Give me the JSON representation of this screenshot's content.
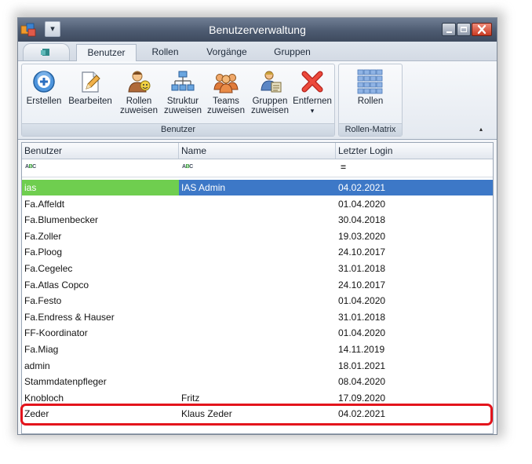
{
  "window": {
    "title": "Benutzerverwaltung",
    "qat_glyph": "▾"
  },
  "tabs": [
    "Benutzer",
    "Rollen",
    "Vorgänge",
    "Gruppen"
  ],
  "ribbon": {
    "buttons": [
      {
        "line1": "Erstellen",
        "line2": ""
      },
      {
        "line1": "Bearbeiten",
        "line2": ""
      },
      {
        "line1": "Rollen",
        "line2": "zuweisen"
      },
      {
        "line1": "Struktur",
        "line2": "zuweisen"
      },
      {
        "line1": "Teams",
        "line2": "zuweisen"
      },
      {
        "line1": "Gruppen",
        "line2": "zuweisen"
      },
      {
        "line1": "Entfernen",
        "line2": "▾"
      }
    ],
    "group1_label": "Benutzer",
    "matrix_button": "Rollen",
    "group2_label": "Rollen-Matrix",
    "collapse_glyph": "▴"
  },
  "grid": {
    "columns": [
      "Benutzer",
      "Name",
      "Letzter Login"
    ],
    "filter": {
      "text_icon": "ABC",
      "date_icon": "="
    },
    "rows": [
      {
        "user": "ias",
        "name": "IAS Admin",
        "login": "04.02.2021"
      },
      {
        "user": "Fa.Affeldt",
        "name": "",
        "login": "01.04.2020"
      },
      {
        "user": "Fa.Blumenbecker",
        "name": "",
        "login": "30.04.2018"
      },
      {
        "user": "Fa.Zoller",
        "name": "",
        "login": "19.03.2020"
      },
      {
        "user": "Fa.Ploog",
        "name": "",
        "login": "24.10.2017"
      },
      {
        "user": "Fa.Cegelec",
        "name": "",
        "login": "31.01.2018"
      },
      {
        "user": "Fa.Atlas Copco",
        "name": "",
        "login": "24.10.2017"
      },
      {
        "user": "Fa.Festo",
        "name": "",
        "login": "01.04.2020"
      },
      {
        "user": "Fa.Endress & Hauser",
        "name": "",
        "login": "31.01.2018"
      },
      {
        "user": "FF-Koordinator",
        "name": "",
        "login": "01.04.2020"
      },
      {
        "user": "Fa.Miag",
        "name": "",
        "login": "14.11.2019"
      },
      {
        "user": "admin",
        "name": "",
        "login": "18.01.2021"
      },
      {
        "user": "Stammdatenpfleger",
        "name": "",
        "login": "08.04.2020"
      },
      {
        "user": "Knobloch",
        "name": "Fritz",
        "login": "17.09.2020"
      },
      {
        "user": "Zeder",
        "name": "Klaus Zeder",
        "login": "04.02.2021"
      }
    ]
  },
  "colors": {
    "selected_row": "#3d78c7",
    "selected_cell": "#6fce4f",
    "highlight_box": "#e3141c",
    "close_button": "#c93b23"
  }
}
